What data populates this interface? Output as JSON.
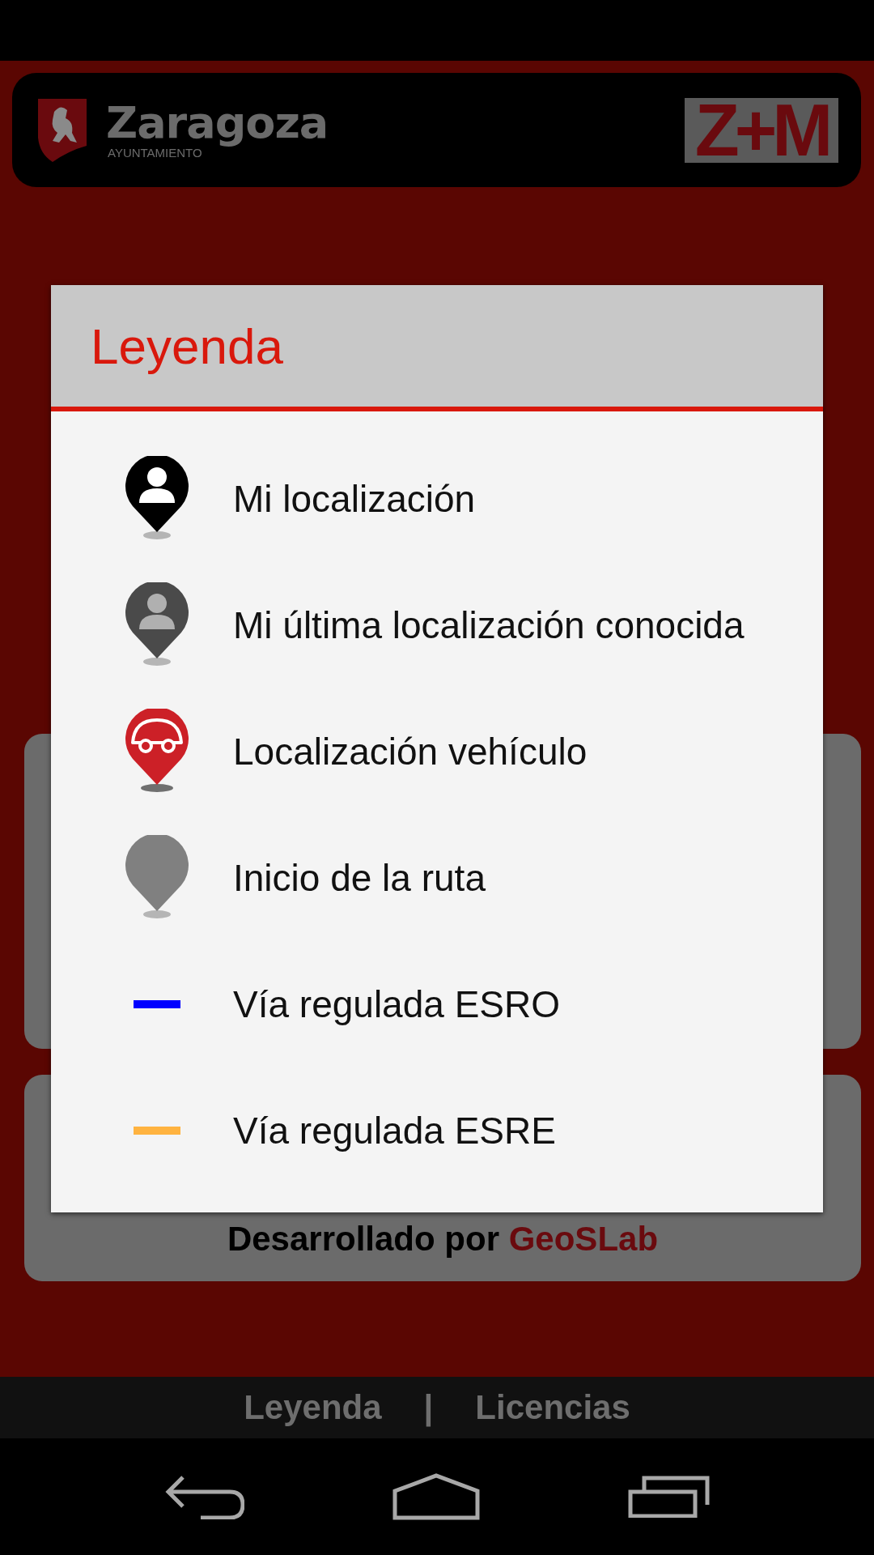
{
  "header": {
    "city": "Zaragoza",
    "subtitle": "AYUNTAMIENTO",
    "logo_text": "Z+M"
  },
  "credits": {
    "text": "Desarrollado por",
    "link": "GeoSLab"
  },
  "dialog": {
    "title": "Leyenda",
    "items": [
      {
        "kind": "pin-person",
        "color": "#000000",
        "label": "Mi localización"
      },
      {
        "kind": "pin-person",
        "color": "#4a4a4a",
        "label": "Mi última localización conocida"
      },
      {
        "kind": "pin-car",
        "color": "#cc2027",
        "label": "Localización vehículo"
      },
      {
        "kind": "pin",
        "color": "#808080",
        "label": "Inicio de la ruta"
      },
      {
        "kind": "line",
        "color": "#0000ff",
        "label": "Vía regulada ESRO"
      },
      {
        "kind": "line",
        "color": "#ffb340",
        "label": "Vía regulada ESRE"
      }
    ]
  },
  "footer": {
    "links": [
      {
        "label": "Leyenda"
      },
      {
        "label": "Licencias"
      }
    ],
    "separator": "|"
  }
}
